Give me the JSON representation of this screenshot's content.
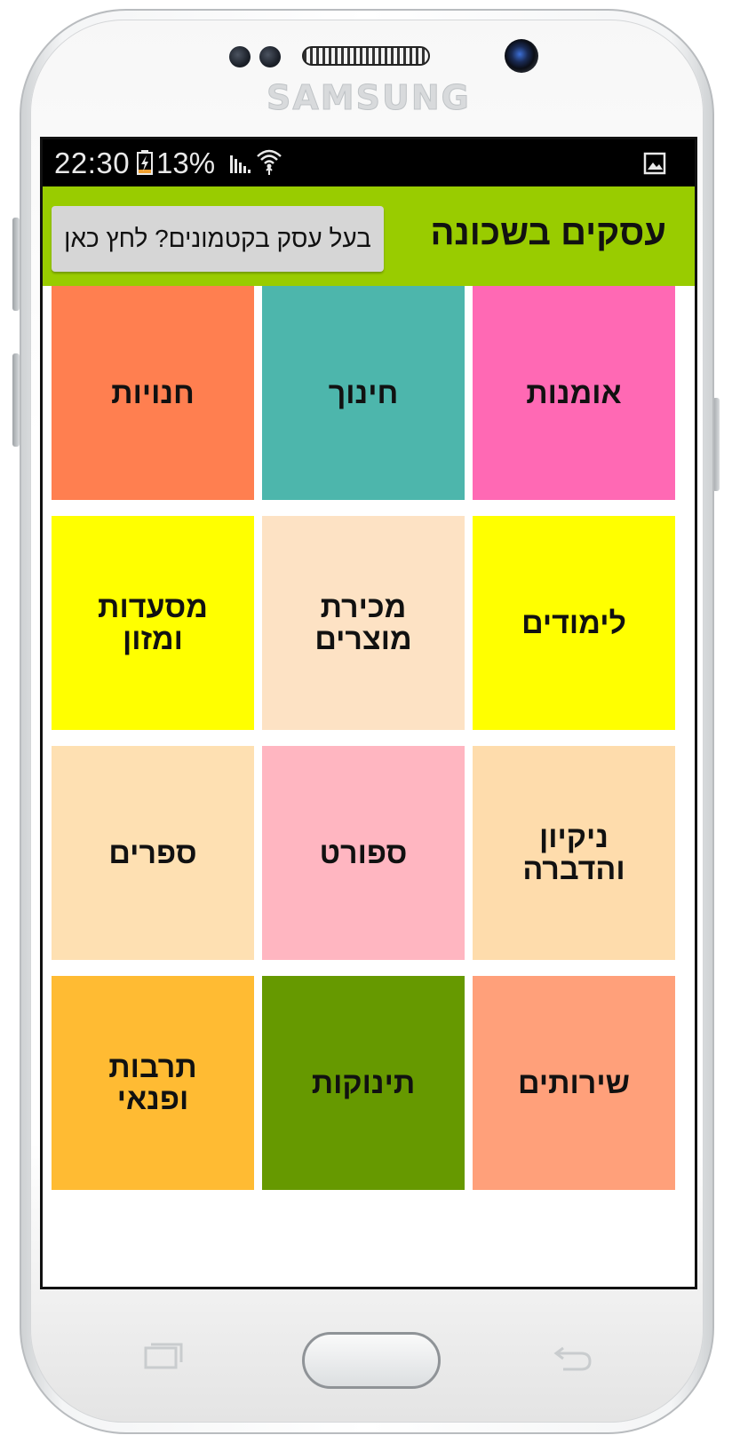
{
  "device": {
    "brand": "SAMSUNG"
  },
  "status_bar": {
    "time": "22:30",
    "battery_percent": "13%",
    "icons": [
      "battery-charging-icon",
      "signal-icon",
      "wifi-icon",
      "gallery-notification-icon"
    ]
  },
  "header": {
    "title": "עסקים בשכונה",
    "owner_button_label": "בעל עסק בקטמונים? לחץ כאן",
    "background": "#99cc00"
  },
  "categories": [
    {
      "label": "אומנות",
      "color": "#ff69b4"
    },
    {
      "label": "חינוך",
      "color": "#4db6ac"
    },
    {
      "label": "חנויות",
      "color": "#ff7f50"
    },
    {
      "label": "לימודים",
      "color": "#ffff00"
    },
    {
      "label": "מכירת מוצרים",
      "color": "#fde2c4"
    },
    {
      "label": "מסעדות ומזון",
      "color": "#ffff00"
    },
    {
      "label": "ניקיון והדברה",
      "color": "#fedcac"
    },
    {
      "label": "ספורט",
      "color": "#ffb6c1"
    },
    {
      "label": "ספרים",
      "color": "#fee0b2"
    },
    {
      "label": "שירותים",
      "color": "#ffa07a"
    },
    {
      "label": "תינוקות",
      "color": "#669900"
    },
    {
      "label": "תרבות ופנאי",
      "color": "#ffbb33"
    }
  ],
  "nav_keys": [
    "recent-apps-icon",
    "home-button",
    "back-icon"
  ]
}
